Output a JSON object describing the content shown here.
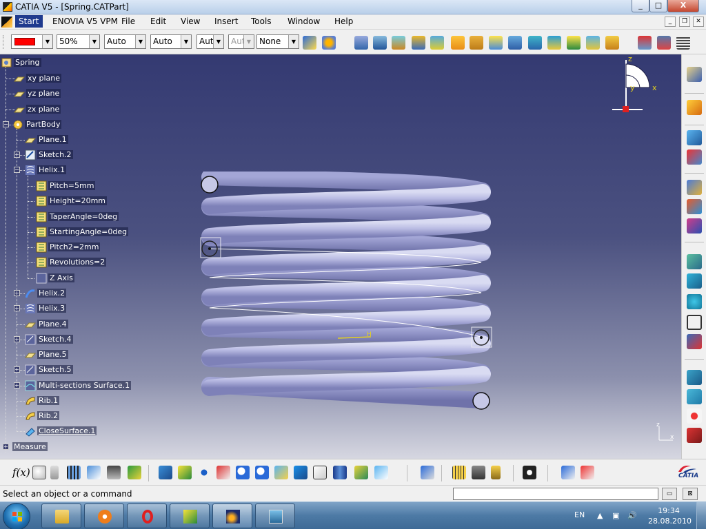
{
  "window": {
    "title": "CATIA V5 - [Spring.CATPart]",
    "minimize": "_",
    "maximize": "□",
    "close": "X"
  },
  "menu": {
    "items": [
      "Start",
      "ENOVIA V5 VPM",
      "File",
      "Edit",
      "View",
      "Insert",
      "Tools",
      "Window",
      "Help"
    ]
  },
  "toolbar": {
    "color": "#ff0000",
    "transparency": "50%",
    "linetype": "Auto",
    "thickness": "Auto",
    "point_symbol": "Aut",
    "layer_disabled": "Aut",
    "layer": "None"
  },
  "tree": {
    "root": "Spring",
    "xy_plane": "xy plane",
    "yz_plane": "yz plane",
    "zx_plane": "zx plane",
    "partbody": "PartBody",
    "plane1": "Plane.1",
    "sketch2": "Sketch.2",
    "helix1": "Helix.1",
    "pitch": "Pitch=5mm",
    "height": "Height=20mm",
    "taper": "TaperAngle=0deg",
    "starting": "StartingAngle=0deg",
    "pitch2": "Pitch2=2mm",
    "revolutions": "Revolutions=2",
    "zaxis": "Z Axis",
    "helix2": "Helix.2",
    "helix3": "Helix.3",
    "plane4": "Plane.4",
    "sketch4": "Sketch.4",
    "plane5": "Plane.5",
    "sketch5": "Sketch.5",
    "multi": "Multi-sections Surface.1",
    "rib1": "Rib.1",
    "rib2": "Rib.2",
    "close": "CloseSurface.1",
    "measure": "Measure"
  },
  "compass": {
    "z": "z",
    "x": "x",
    "y": "y"
  },
  "mini_axis": {
    "z": "z",
    "x": "x"
  },
  "status": {
    "prompt": "Select an object or a command",
    "command_value": ""
  },
  "bottom": {
    "fx": "f(x)",
    "catia_logo": "CATIA"
  },
  "taskbar": {
    "language": "EN",
    "time": "19:34",
    "date": "28.08.2010"
  }
}
